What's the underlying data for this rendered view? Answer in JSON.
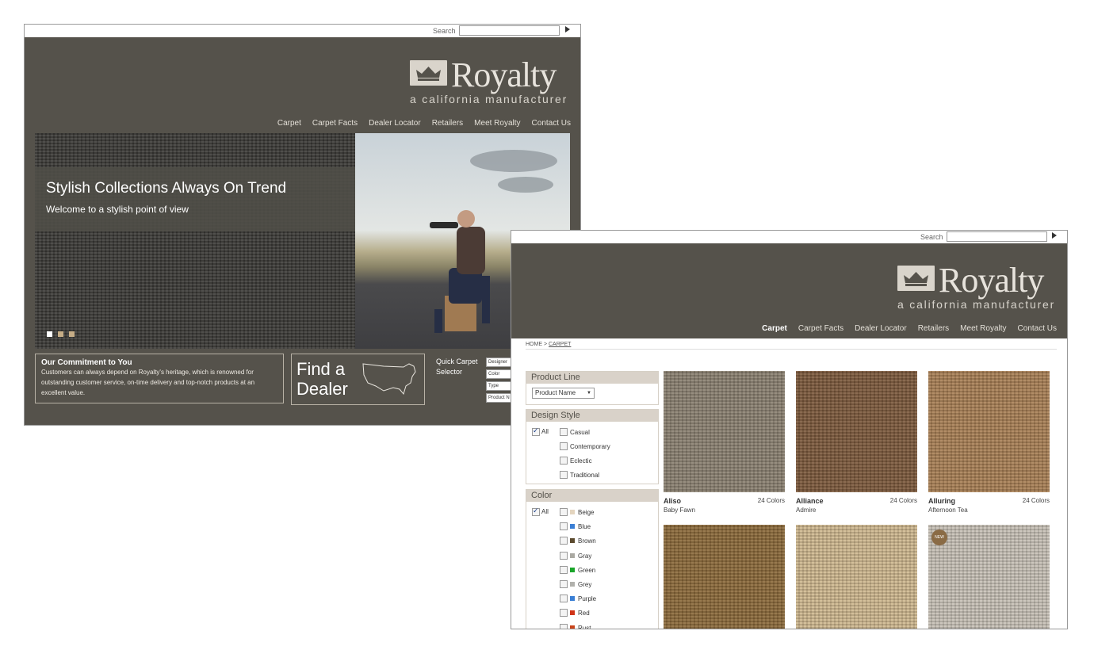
{
  "home": {
    "search_label": "Search",
    "brand": "Royalty",
    "tagline": "a california manufacturer",
    "nav": [
      "Carpet",
      "Carpet Facts",
      "Dealer Locator",
      "Retailers",
      "Meet Royalty",
      "Contact Us"
    ],
    "hero_title": "Stylish Collections Always On Trend",
    "hero_subtitle": "Welcome to a stylish point of view",
    "commitment_title": "Our Commitment to You",
    "commitment_text": "Customers can always depend on Royalty's heritage, which is renowned for outstanding customer service, on-time delivery and top-notch products at an excellent value.",
    "dealer_line1": "Find a",
    "dealer_line2": "Dealer",
    "quick_line1": "Quick Carpet",
    "quick_line2": "Selector",
    "quick_selects": [
      "Designer",
      "Color",
      "Type",
      "Product N"
    ]
  },
  "catalog": {
    "search_label": "Search",
    "brand": "Royalty",
    "tagline": "a california manufacturer",
    "nav": [
      "Carpet",
      "Carpet Facts",
      "Dealer Locator",
      "Retailers",
      "Meet Royalty",
      "Contact Us"
    ],
    "breadcrumb_home": "HOME",
    "breadcrumb_sep": ">",
    "breadcrumb_current": "CARPET",
    "product_line_title": "Product Line",
    "product_line_select": "Product Name",
    "design_title": "Design Style",
    "design_all": "All",
    "design_options": [
      "Casual",
      "Contemporary",
      "Eclectic",
      "Traditional"
    ],
    "color_title": "Color",
    "color_all": "All",
    "colors": [
      {
        "name": "Beige",
        "hex": "#e4d5bf"
      },
      {
        "name": "Blue",
        "hex": "#3a7fd5"
      },
      {
        "name": "Brown",
        "hex": "#5b4a2e"
      },
      {
        "name": "Gray",
        "hex": "#aaa9a2"
      },
      {
        "name": "Green",
        "hex": "#1aa52a"
      },
      {
        "name": "Grey",
        "hex": "#b1b1ac"
      },
      {
        "name": "Purple",
        "hex": "#3a7fd5"
      },
      {
        "name": "Red",
        "hex": "#d03418"
      },
      {
        "name": "Rust",
        "hex": "#c9441a"
      }
    ],
    "products": [
      {
        "name": "Aliso",
        "colors": "24 Colors",
        "sub": "Baby Fawn",
        "hex": "#8b8171"
      },
      {
        "name": "Alliance",
        "colors": "24 Colors",
        "sub": "Admire",
        "hex": "#7d5a3c"
      },
      {
        "name": "Alluring",
        "colors": "24 Colors",
        "sub": "Afternoon Tea",
        "hex": "#a98055"
      },
      {
        "name": "",
        "colors": "",
        "sub": "",
        "hex": "#8c6a3a"
      },
      {
        "name": "",
        "colors": "",
        "sub": "",
        "hex": "#cfb88f"
      },
      {
        "name": "",
        "colors": "",
        "sub": "",
        "hex": "#c7c1b6"
      }
    ],
    "new_badge": "NEW"
  }
}
